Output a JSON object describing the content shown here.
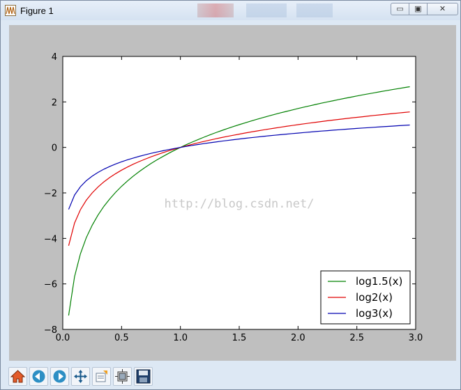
{
  "window": {
    "title": "Figure 1",
    "buttons": {
      "minimize": "▭",
      "maximize": "▣",
      "close": "✕"
    }
  },
  "watermark": "http://blog.csdn.net/",
  "toolbar": {
    "items": [
      {
        "name": "home-icon"
      },
      {
        "name": "back-icon"
      },
      {
        "name": "forward-icon"
      },
      {
        "name": "pan-icon"
      },
      {
        "name": "zoom-icon"
      },
      {
        "name": "subplots-icon"
      },
      {
        "name": "save-icon"
      }
    ]
  },
  "chart_data": {
    "type": "line",
    "title": "",
    "xlabel": "",
    "ylabel": "",
    "xlim": [
      0.0,
      3.0
    ],
    "ylim": [
      -8,
      4
    ],
    "xticks": [
      0.0,
      0.5,
      1.0,
      1.5,
      2.0,
      2.5,
      3.0
    ],
    "xtick_labels": [
      "0.0",
      "0.5",
      "1.0",
      "1.5",
      "2.0",
      "2.5",
      "3.0"
    ],
    "yticks": [
      4,
      2,
      0,
      -2,
      -4,
      -6,
      -8
    ],
    "ytick_labels": [
      "4",
      "2",
      "0",
      "−2",
      "−4",
      "−6",
      "−8"
    ],
    "grid": false,
    "legend_position": "lower-right",
    "x_range": [
      0.05,
      2.95
    ],
    "series": [
      {
        "name": "log1.5(x)",
        "base": 1.5,
        "color": "#008000"
      },
      {
        "name": "log2(x)",
        "base": 2,
        "color": "#e00000"
      },
      {
        "name": "log3(x)",
        "base": 3,
        "color": "#0000b0"
      }
    ]
  }
}
